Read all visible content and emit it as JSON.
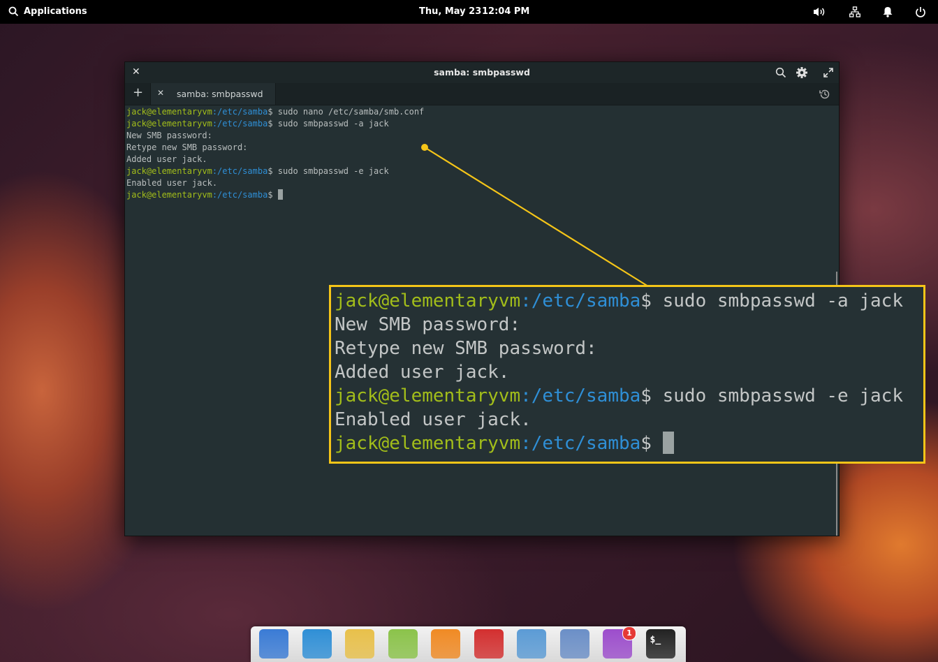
{
  "panel": {
    "applications_label": "Applications",
    "date": "Thu, May 23",
    "time": "12:04 PM",
    "indicators": [
      "volume-icon",
      "network-icon",
      "notifications-icon",
      "power-icon"
    ]
  },
  "window": {
    "title": "samba: smbpasswd",
    "tab_label": "samba: smbpasswd"
  },
  "terminal": {
    "user_host": "jack@elementaryvm",
    "path": ":/etc/samba",
    "prompt_char": "$",
    "lines": [
      {
        "kind": "prompt",
        "command": " sudo nano /etc/samba/smb.conf"
      },
      {
        "kind": "prompt",
        "command": " sudo smbpasswd -a jack"
      },
      {
        "kind": "output",
        "text": "New SMB password:"
      },
      {
        "kind": "output",
        "text": "Retype new SMB password:"
      },
      {
        "kind": "output",
        "text": "Added user jack."
      },
      {
        "kind": "prompt",
        "command": " sudo smbpasswd -e jack"
      },
      {
        "kind": "output",
        "text": "Enabled user jack."
      },
      {
        "kind": "prompt",
        "command": " ",
        "cursor": true
      }
    ]
  },
  "callout": {
    "border_color": "#f5c518",
    "lines": [
      {
        "kind": "prompt",
        "command": " sudo smbpasswd -a jack"
      },
      {
        "kind": "output",
        "text": "New SMB password:"
      },
      {
        "kind": "output",
        "text": "Retype new SMB password:"
      },
      {
        "kind": "output",
        "text": "Added user jack."
      },
      {
        "kind": "prompt",
        "command": " sudo smbpasswd -e jack"
      },
      {
        "kind": "output",
        "text": "Enabled user jack."
      },
      {
        "kind": "prompt",
        "command": " ",
        "cursor": true
      }
    ]
  },
  "dock": {
    "items": [
      {
        "name": "multitasking-view-icon",
        "color": "#3a7bd5"
      },
      {
        "name": "web-browser-icon",
        "color": "#2f8fd6"
      },
      {
        "name": "mail-icon",
        "color": "#e8c04a"
      },
      {
        "name": "calendar-icon",
        "color": "#8bc34a"
      },
      {
        "name": "music-icon",
        "color": "#f08a24"
      },
      {
        "name": "videos-icon",
        "color": "#d32f2f"
      },
      {
        "name": "photos-icon",
        "color": "#5b9bd5"
      },
      {
        "name": "settings-icon",
        "color": "#6b8fc7"
      },
      {
        "name": "appcenter-icon",
        "color": "#9c4dcc",
        "badge": "1"
      },
      {
        "name": "terminal-icon",
        "color": "#222222",
        "glyph": "$_"
      }
    ]
  },
  "colors": {
    "prompt_user": "#a2bd1a",
    "prompt_path": "#2f8fd6",
    "terminal_bg": "#243033"
  }
}
